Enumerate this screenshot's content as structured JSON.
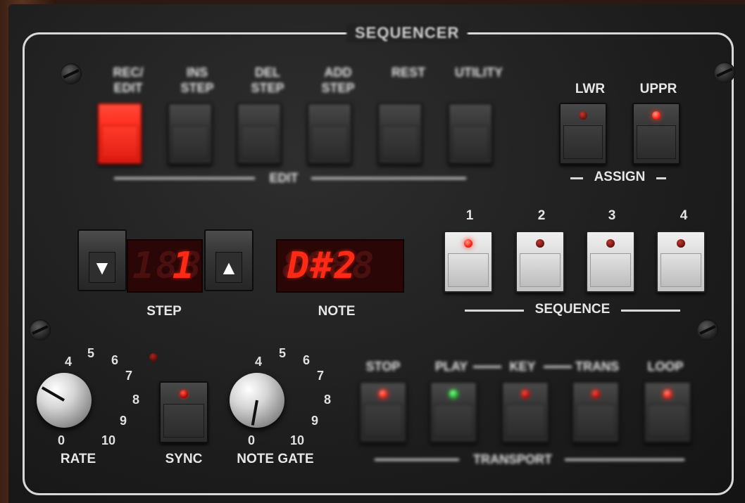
{
  "panel_title": "SEQUENCER",
  "edit": {
    "group_label": "EDIT",
    "buttons": [
      {
        "label_line1": "REC/",
        "label_line2": "EDIT",
        "active": true
      },
      {
        "label_line1": "INS",
        "label_line2": "STEP",
        "active": false
      },
      {
        "label_line1": "DEL",
        "label_line2": "STEP",
        "active": false
      },
      {
        "label_line1": "ADD",
        "label_line2": "STEP",
        "active": false
      },
      {
        "label_line1": "",
        "label_line2": "REST",
        "active": false
      },
      {
        "label_line1": "",
        "label_line2": "UTILITY",
        "active": false
      }
    ]
  },
  "assign": {
    "group_label": "ASSIGN",
    "lwr_label": "LWR",
    "uppr_label": "UPPR"
  },
  "step": {
    "label": "STEP",
    "ghost": "188",
    "value": "1",
    "down_glyph": "▼",
    "up_glyph": "▲"
  },
  "note": {
    "label": "NOTE",
    "ghost": "8888",
    "value": "D#2"
  },
  "sequence": {
    "group_label": "SEQUENCE",
    "numbers": [
      "1",
      "2",
      "3",
      "4"
    ]
  },
  "rate": {
    "label": "RATE",
    "ticks": [
      "0",
      "4",
      "5",
      "6",
      "7",
      "8",
      "9",
      "10"
    ]
  },
  "sync": {
    "label": "SYNC"
  },
  "note_gate": {
    "label": "NOTE GATE",
    "ticks": [
      "0",
      "4",
      "5",
      "6",
      "7",
      "8",
      "9",
      "10"
    ]
  },
  "transport": {
    "group_label": "TRANSPORT",
    "buttons": [
      "STOP",
      "PLAY",
      "KEY",
      "TRANS",
      "LOOP"
    ]
  },
  "colors": {
    "led_red": "#ff2a1a",
    "led_green": "#30e040",
    "lcd_red": "#ff2a16",
    "panel": "#1d1d1d"
  }
}
